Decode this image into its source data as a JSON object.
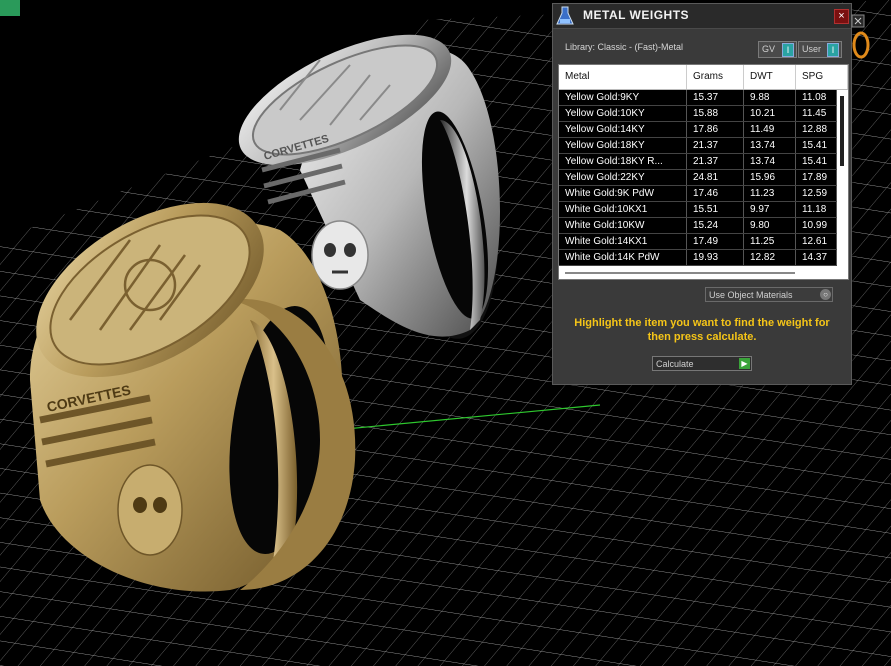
{
  "window": {
    "title": "METAL WEIGHTS",
    "close_label": "×",
    "library_label": "Library: Classic - (Fast)-Metal",
    "toggles": [
      {
        "label": "GV",
        "state": "I"
      },
      {
        "label": "User",
        "state": "I"
      }
    ]
  },
  "table": {
    "columns": [
      "Metal",
      "Grams",
      "DWT",
      "SPG"
    ],
    "rows": [
      [
        "Yellow Gold:9KY",
        "15.37",
        "9.88",
        "11.08"
      ],
      [
        "Yellow Gold:10KY",
        "15.88",
        "10.21",
        "11.45"
      ],
      [
        "Yellow Gold:14KY",
        "17.86",
        "11.49",
        "12.88"
      ],
      [
        "Yellow Gold:18KY",
        "21.37",
        "13.74",
        "15.41"
      ],
      [
        "Yellow Gold:18KY R...",
        "21.37",
        "13.74",
        "15.41"
      ],
      [
        "Yellow Gold:22KY",
        "24.81",
        "15.96",
        "17.89"
      ],
      [
        "White Gold:9K PdW",
        "17.46",
        "11.23",
        "12.59"
      ],
      [
        "White Gold:10KX1",
        "15.51",
        "9.97",
        "11.18"
      ],
      [
        "White Gold:10KW",
        "15.24",
        "9.80",
        "10.99"
      ],
      [
        "White Gold:14KX1",
        "17.49",
        "11.25",
        "12.61"
      ],
      [
        "White Gold:14K PdW",
        "19.93",
        "12.82",
        "14.37"
      ]
    ]
  },
  "materials_dropdown": {
    "value": "Use Object Materials",
    "arrow": "○"
  },
  "instructions": "Highlight the item you want to find the weight for then press calculate.",
  "calculate_button": {
    "label": "Calculate",
    "go": "▶"
  },
  "ring_engraving": "CORVETTES",
  "colors": {
    "accent_yellow": "#f5c518",
    "toggle_teal": "#2aa3a3",
    "grid_line": "#bdbdbd",
    "gold": "#b59a5a",
    "silver": "#b8b8b8"
  }
}
